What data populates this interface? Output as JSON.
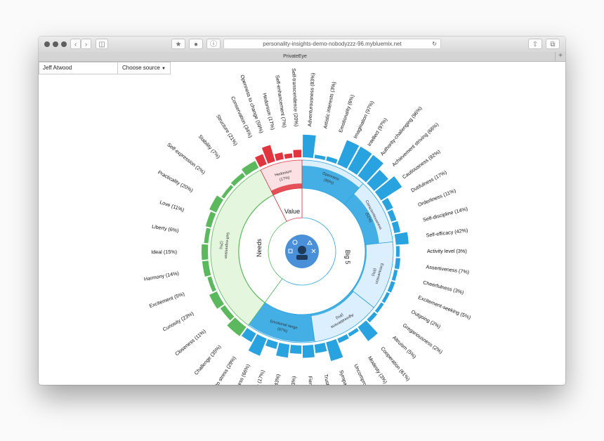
{
  "browser": {
    "url": "personality-insights-demo-nobodyzzz-96.mybluemix.net",
    "tab_title": "PrivateEye",
    "new_tab_label": "+"
  },
  "toolbar": {
    "user_name": "Jeff Atwood",
    "source_label": "Choose source"
  },
  "chart": {
    "center_icon": "personality-icon",
    "category_labels": {
      "big5": "Big 5",
      "needs": "Needs",
      "value": "Value"
    },
    "mid_labels": [
      {
        "key": "openness",
        "label": "Openness",
        "pct": "(80%)"
      },
      {
        "key": "conscientiousness",
        "label": "Conscientiousness",
        "pct": "(51%)"
      },
      {
        "key": "extraversion",
        "label": "Extraversion",
        "pct": "(5%)"
      },
      {
        "key": "agreeableness",
        "label": "Agreeableness",
        "pct": "(8%)"
      },
      {
        "key": "emotional",
        "label": "Emotional range",
        "pct": "(97%)"
      },
      {
        "key": "selfexpr",
        "label": "Self-expression",
        "pct": "(2%)"
      },
      {
        "key": "hedonism",
        "label": "Hedonism",
        "pct": "(17%)"
      }
    ],
    "colors": {
      "big5": "#29a3e0",
      "needs": "#5cb85c",
      "value": "#e0353f",
      "icon": "#4a90d9"
    }
  },
  "chart_data": {
    "type": "sunburst",
    "categories": [
      "Big 5",
      "Needs",
      "Value"
    ],
    "leaves": [
      {
        "label": "Adventurousness (83%)",
        "group": "Big 5",
        "value": 83
      },
      {
        "label": "Artistic interests (3%)",
        "group": "Big 5",
        "value": 3
      },
      {
        "label": "Emotionality (6%)",
        "group": "Big 5",
        "value": 6
      },
      {
        "label": "Imagination (97%)",
        "group": "Big 5",
        "value": 97
      },
      {
        "label": "Intellect (97%)",
        "group": "Big 5",
        "value": 97
      },
      {
        "label": "Authority-challenging (96%)",
        "group": "Big 5",
        "value": 96
      },
      {
        "label": "Achievement striving (66%)",
        "group": "Big 5",
        "value": 66
      },
      {
        "label": "Cautiousness (92%)",
        "group": "Big 5",
        "value": 92
      },
      {
        "label": "Dutifulness (17%)",
        "group": "Big 5",
        "value": 17
      },
      {
        "label": "Orderliness (11%)",
        "group": "Big 5",
        "value": 11
      },
      {
        "label": "Self-discipline (14%)",
        "group": "Big 5",
        "value": 14
      },
      {
        "label": "Self-efficacy (42%)",
        "group": "Big 5",
        "value": 42
      },
      {
        "label": "Activity level (3%)",
        "group": "Big 5",
        "value": 3
      },
      {
        "label": "Assertiveness (7%)",
        "group": "Big 5",
        "value": 7
      },
      {
        "label": "Cheerfulness (3%)",
        "group": "Big 5",
        "value": 3
      },
      {
        "label": "Excitement-seeking (5%)",
        "group": "Big 5",
        "value": 5
      },
      {
        "label": "Outgoing (2%)",
        "group": "Big 5",
        "value": 2
      },
      {
        "label": "Gregariousness (2%)",
        "group": "Big 5",
        "value": 2
      },
      {
        "label": "Altruism (5%)",
        "group": "Big 5",
        "value": 5
      },
      {
        "label": "Cooperation (61%)",
        "group": "Big 5",
        "value": 61
      },
      {
        "label": "Modesty (3%)",
        "group": "Big 5",
        "value": 3
      },
      {
        "label": "Uncompromising (8%)",
        "group": "Big 5",
        "value": 8
      },
      {
        "label": "Sympathy (69%)",
        "group": "Big 5",
        "value": 69
      },
      {
        "label": "Trust (24%)",
        "group": "Big 5",
        "value": 24
      },
      {
        "label": "Fiery (40%)",
        "group": "Big 5",
        "value": 40
      },
      {
        "label": "Prone to worry (23%)",
        "group": "Big 5",
        "value": 23
      },
      {
        "label": "Melancholy (43%)",
        "group": "Big 5",
        "value": 43
      },
      {
        "label": "Immoderation (17%)",
        "group": "Big 5",
        "value": 17
      },
      {
        "label": "Self-consciousness (66%)",
        "group": "Big 5",
        "value": 66
      },
      {
        "label": "Susceptible to stress (29%)",
        "group": "Big 5",
        "value": 29
      },
      {
        "label": "Challenge (35%)",
        "group": "Needs",
        "value": 35
      },
      {
        "label": "Closeness (11%)",
        "group": "Needs",
        "value": 11
      },
      {
        "label": "Curiosity (23%)",
        "group": "Needs",
        "value": 23
      },
      {
        "label": "Excitement (5%)",
        "group": "Needs",
        "value": 5
      },
      {
        "label": "Harmony (14%)",
        "group": "Needs",
        "value": 14
      },
      {
        "label": "Ideal (15%)",
        "group": "Needs",
        "value": 15
      },
      {
        "label": "Liberty (6%)",
        "group": "Needs",
        "value": 6
      },
      {
        "label": "Love (11%)",
        "group": "Needs",
        "value": 11
      },
      {
        "label": "Practicality (20%)",
        "group": "Needs",
        "value": 20
      },
      {
        "label": "Self-expression (2%)",
        "group": "Needs",
        "value": 2
      },
      {
        "label": "Stability (7%)",
        "group": "Needs",
        "value": 7
      },
      {
        "label": "Structure (21%)",
        "group": "Needs",
        "value": 21
      },
      {
        "label": "Conservation (34%)",
        "group": "Value",
        "value": 34
      },
      {
        "label": "Openness to change (59%)",
        "group": "Value",
        "value": 59
      },
      {
        "label": "Hedonism (17%)",
        "group": "Value",
        "value": 17
      },
      {
        "label": "Self-enhancement (7%)",
        "group": "Value",
        "value": 7
      },
      {
        "label": "Self-transcendence (20%)",
        "group": "Value",
        "value": 20
      }
    ]
  }
}
